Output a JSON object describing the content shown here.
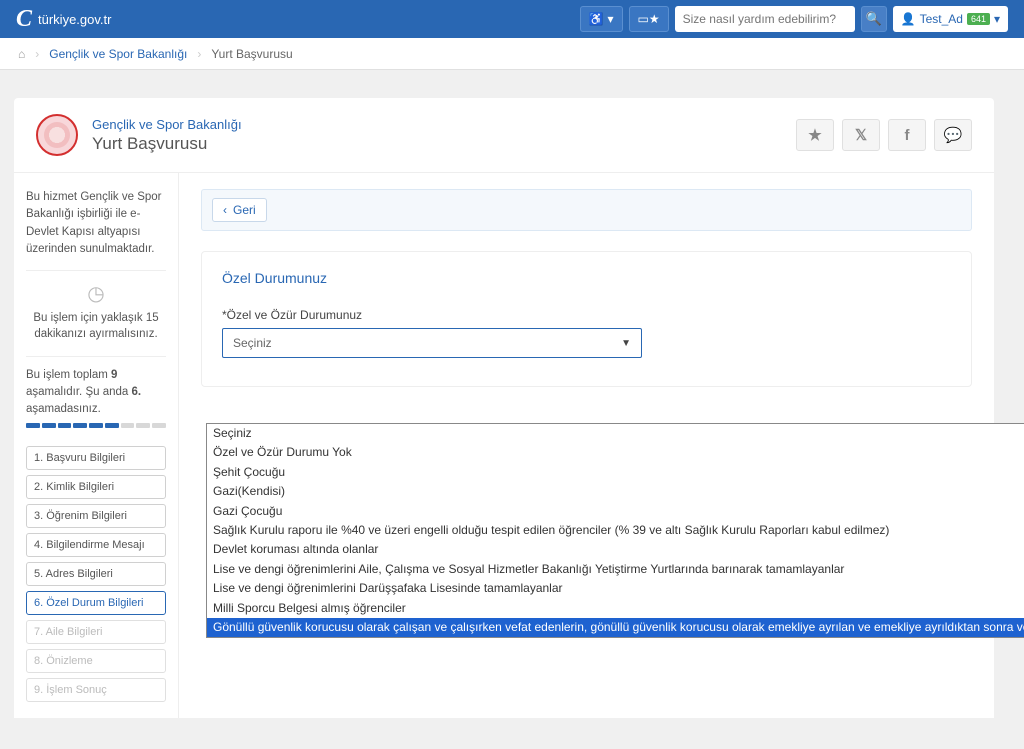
{
  "topbar": {
    "brand": "türkiye.gov.tr",
    "search_placeholder": "Size nasıl yardım edebilirim?",
    "user_name": "Test_Ad",
    "user_badge": "641"
  },
  "breadcrumb": {
    "agency": "Gençlik ve Spor Bakanlığı",
    "current": "Yurt Başvurusu"
  },
  "header": {
    "agency": "Gençlik ve Spor Bakanlığı",
    "title": "Yurt Başvurusu"
  },
  "sidebar": {
    "info_text": "Bu hizmet Gençlik ve Spor Bakanlığı işbirliği ile e-Devlet Kapısı altyapısı üzerinden sunulmaktadır.",
    "time_text": "Bu işlem için yaklaşık 15 dakikanızı ayırmalısınız.",
    "steps_text_1": "Bu işlem toplam ",
    "steps_total": "9",
    "steps_text_2": " aşamalıdır. Şu anda ",
    "steps_current": "6.",
    "steps_text_3": " aşamadasınız.",
    "steps": [
      {
        "label": "1. Başvuru Bilgileri",
        "state": "normal"
      },
      {
        "label": "2. Kimlik Bilgileri",
        "state": "normal"
      },
      {
        "label": "3. Öğrenim Bilgileri",
        "state": "normal"
      },
      {
        "label": "4. Bilgilendirme Mesajı",
        "state": "normal"
      },
      {
        "label": "5. Adres Bilgileri",
        "state": "normal"
      },
      {
        "label": "6. Özel Durum Bilgileri",
        "state": "active"
      },
      {
        "label": "7. Aile Bilgileri",
        "state": "disabled"
      },
      {
        "label": "8. Önizleme",
        "state": "disabled"
      },
      {
        "label": "9. İşlem Sonuç",
        "state": "disabled"
      }
    ]
  },
  "main": {
    "back_label": "Geri",
    "section_title": "Özel Durumunuz",
    "field_label": "*Özel ve Özür Durumunuz",
    "select_value": "Seçiniz"
  },
  "dropdown": {
    "options": [
      "Seçiniz",
      "Özel ve Özür Durumu Yok",
      "Şehit Çocuğu",
      "Gazi(Kendisi)",
      "Gazi Çocuğu",
      "Sağlık Kurulu raporu ile %40 ve üzeri engelli olduğu tespit edilen öğrenciler (% 39 ve altı Sağlık Kurulu Raporları kabul edilmez)",
      "Devlet koruması altında olanlar",
      "Lise ve dengi öğrenimlerini Aile, Çalışma ve Sosyal Hizmetler Bakanlığı Yetiştirme Yurtlarında barınarak tamamlayanlar",
      "Lise ve dengi öğrenimlerini Darüşşafaka Lisesinde tamamlayanlar",
      "Milli Sporcu Belgesi almış öğrenciler",
      "Gönüllü güvenlik korucusu olarak çalışan ve çalışırken vefat edenlerin, gönüllü güvenlik korucusu olarak emekliye ayrılan ve emekliye ayrıldıktan sonra vefat edenlerin çocukları"
    ],
    "highlight_index": 10
  }
}
